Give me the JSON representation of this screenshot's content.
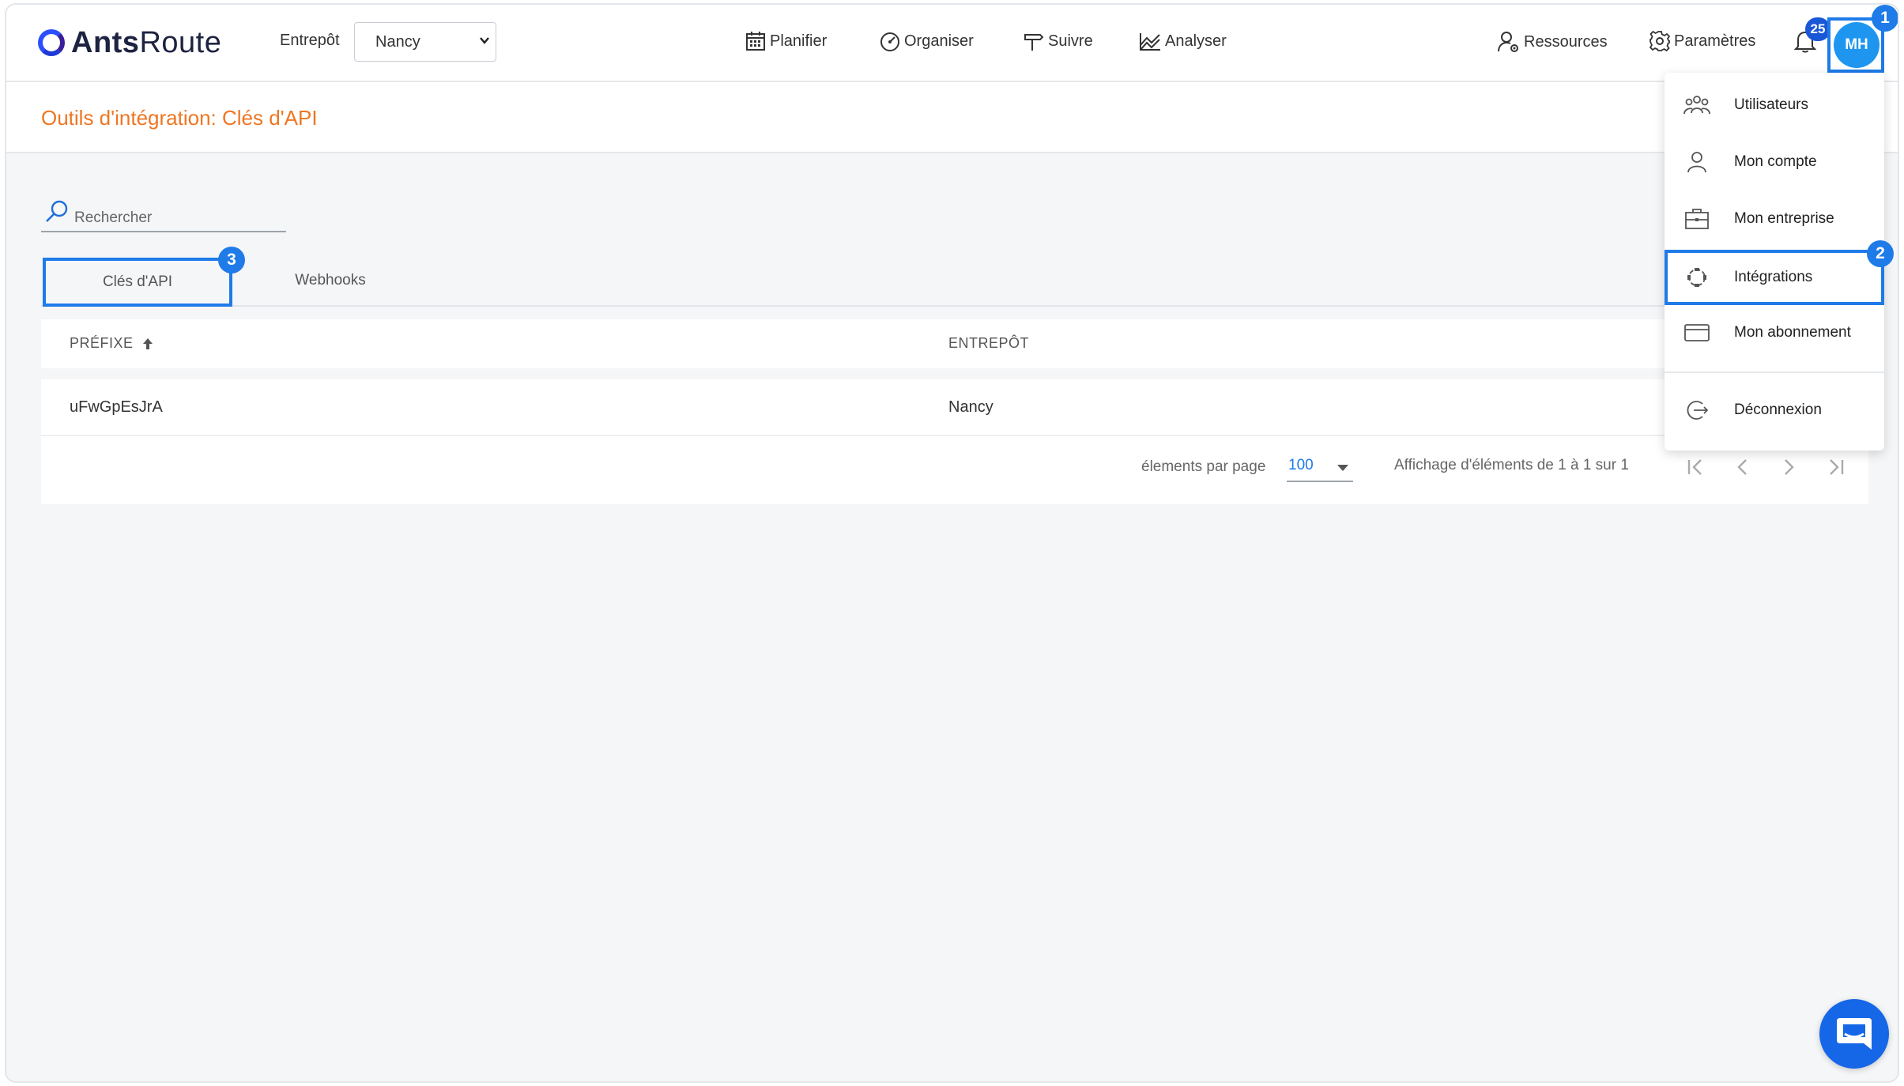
{
  "app": {
    "logo_bold": "Ants",
    "logo_light": "Route"
  },
  "header": {
    "warehouse_label": "Entrepôt",
    "warehouse_value": "Nancy",
    "nav": [
      {
        "label": "Planifier",
        "icon": "calendar-icon"
      },
      {
        "label": "Organiser",
        "icon": "speedometer-icon"
      },
      {
        "label": "Suivre",
        "icon": "signpost-icon"
      },
      {
        "label": "Analyser",
        "icon": "chart-icon"
      }
    ],
    "resources_label": "Ressources",
    "settings_label": "Paramètres",
    "notification_count": "25",
    "avatar_initials": "MH"
  },
  "page": {
    "title": "Outils d'intégration: Clés d'API"
  },
  "search": {
    "placeholder": "Rechercher"
  },
  "tabs": [
    {
      "label": "Clés d'API",
      "active": true
    },
    {
      "label": "Webhooks",
      "active": false
    }
  ],
  "table": {
    "columns": [
      "PRÉFIXE",
      "ENTREPÔT"
    ],
    "rows": [
      {
        "prefix": "uFwGpEsJrA",
        "warehouse": "Nancy"
      }
    ]
  },
  "pagination": {
    "per_page_label": "élements par page",
    "per_page_value": "100",
    "info": "Affichage d'éléments de 1 à 1 sur 1"
  },
  "user_menu": {
    "items": [
      {
        "label": "Utilisateurs",
        "icon": "users-icon"
      },
      {
        "label": "Mon compte",
        "icon": "user-icon"
      },
      {
        "label": "Mon entreprise",
        "icon": "briefcase-icon"
      },
      {
        "label": "Intégrations",
        "icon": "integrations-icon"
      },
      {
        "label": "Mon abonnement",
        "icon": "credit-card-icon"
      },
      {
        "label": "Déconnexion",
        "icon": "logout-icon"
      }
    ]
  },
  "annotations": {
    "step_1": "1",
    "step_2": "2",
    "step_3": "3"
  },
  "colors": {
    "accent": "#1e7be8",
    "title_orange": "#ee7623",
    "logo_blue": "#2b4fff"
  }
}
